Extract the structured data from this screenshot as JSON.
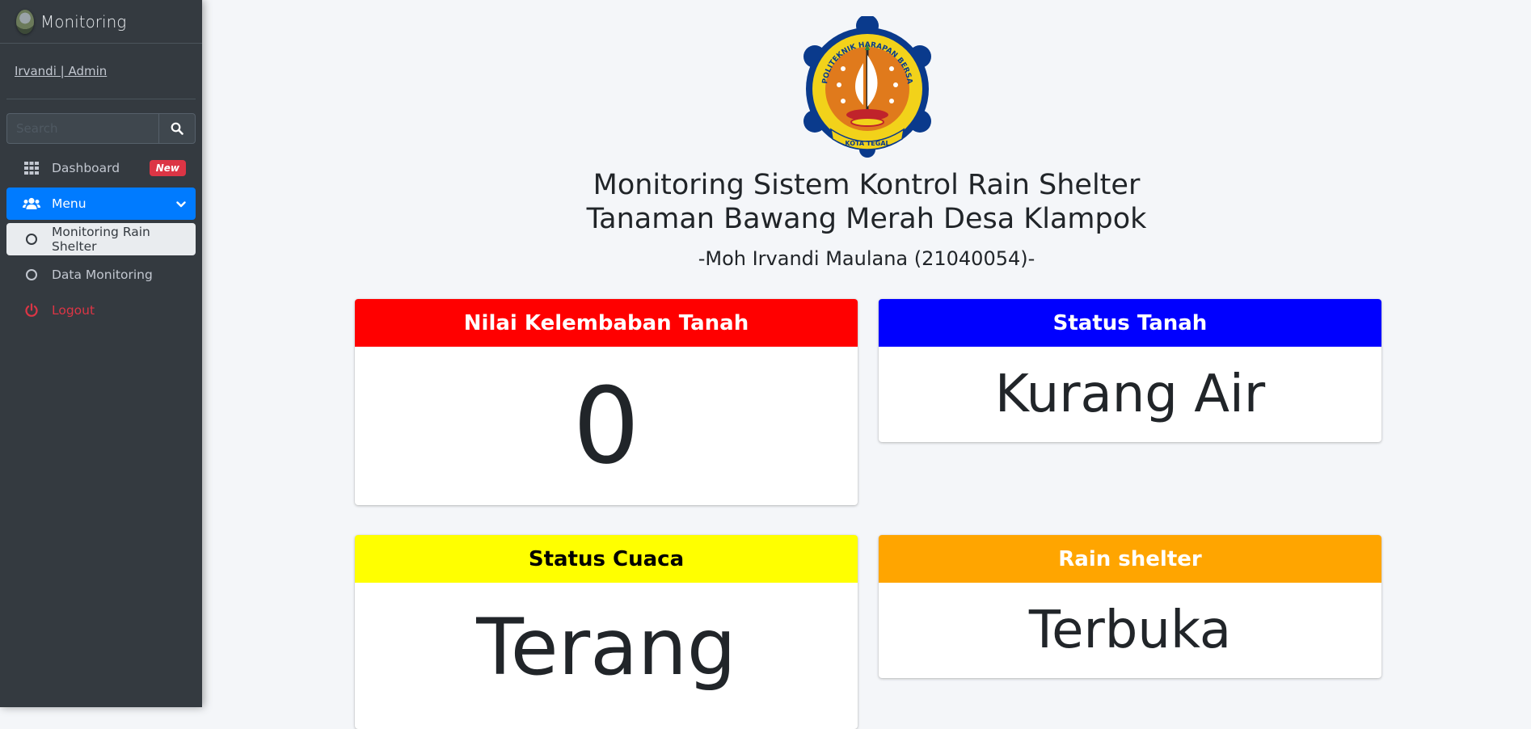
{
  "brand": {
    "title": "Monitoring",
    "logo_icon": "user-avatar-icon"
  },
  "user": {
    "label": "Irvandi | Admin"
  },
  "search": {
    "placeholder": "Search",
    "icon": "search-icon"
  },
  "sidebar": {
    "items": [
      {
        "label": "Dashboard",
        "icon": "grid-icon",
        "badge": "New"
      },
      {
        "label": "Menu",
        "icon": "users-icon",
        "chevron": "chevron-down-icon"
      },
      {
        "label": "Monitoring Rain Shelter",
        "icon": "circle-icon"
      },
      {
        "label": "Data Monitoring",
        "icon": "circle-icon"
      },
      {
        "label": "Logout",
        "icon": "power-icon"
      }
    ]
  },
  "header": {
    "title_line1": "Monitoring Sistem Kontrol Rain Shelter",
    "title_line2": "Tanaman Bawang Merah Desa Klampok",
    "subtitle": "-Moh Irvandi Maulana (21040054)-",
    "emblem_arc_text": "POLITEKNIK HARAPAN BERSAMA",
    "emblem_bottom_text": "KOTA TEGAL"
  },
  "cards": [
    {
      "title": "Nilai Kelembaban Tanah",
      "value": "0",
      "color": "#ff0000",
      "text_color": "#ffffff"
    },
    {
      "title": "Status Tanah",
      "value": "Kurang Air",
      "color": "#0000ff",
      "text_color": "#ffffff"
    },
    {
      "title": "Status Cuaca",
      "value": "Terang",
      "color": "#ffff00",
      "text_color": "#000000"
    },
    {
      "title": "Rain shelter",
      "value": "Terbuka",
      "color": "#ffa500",
      "text_color": "#ffffff"
    }
  ],
  "colors": {
    "sidebar_bg": "#343a40",
    "accent": "#007bff",
    "danger": "#dc3545",
    "page_bg": "#f4f6f9"
  }
}
